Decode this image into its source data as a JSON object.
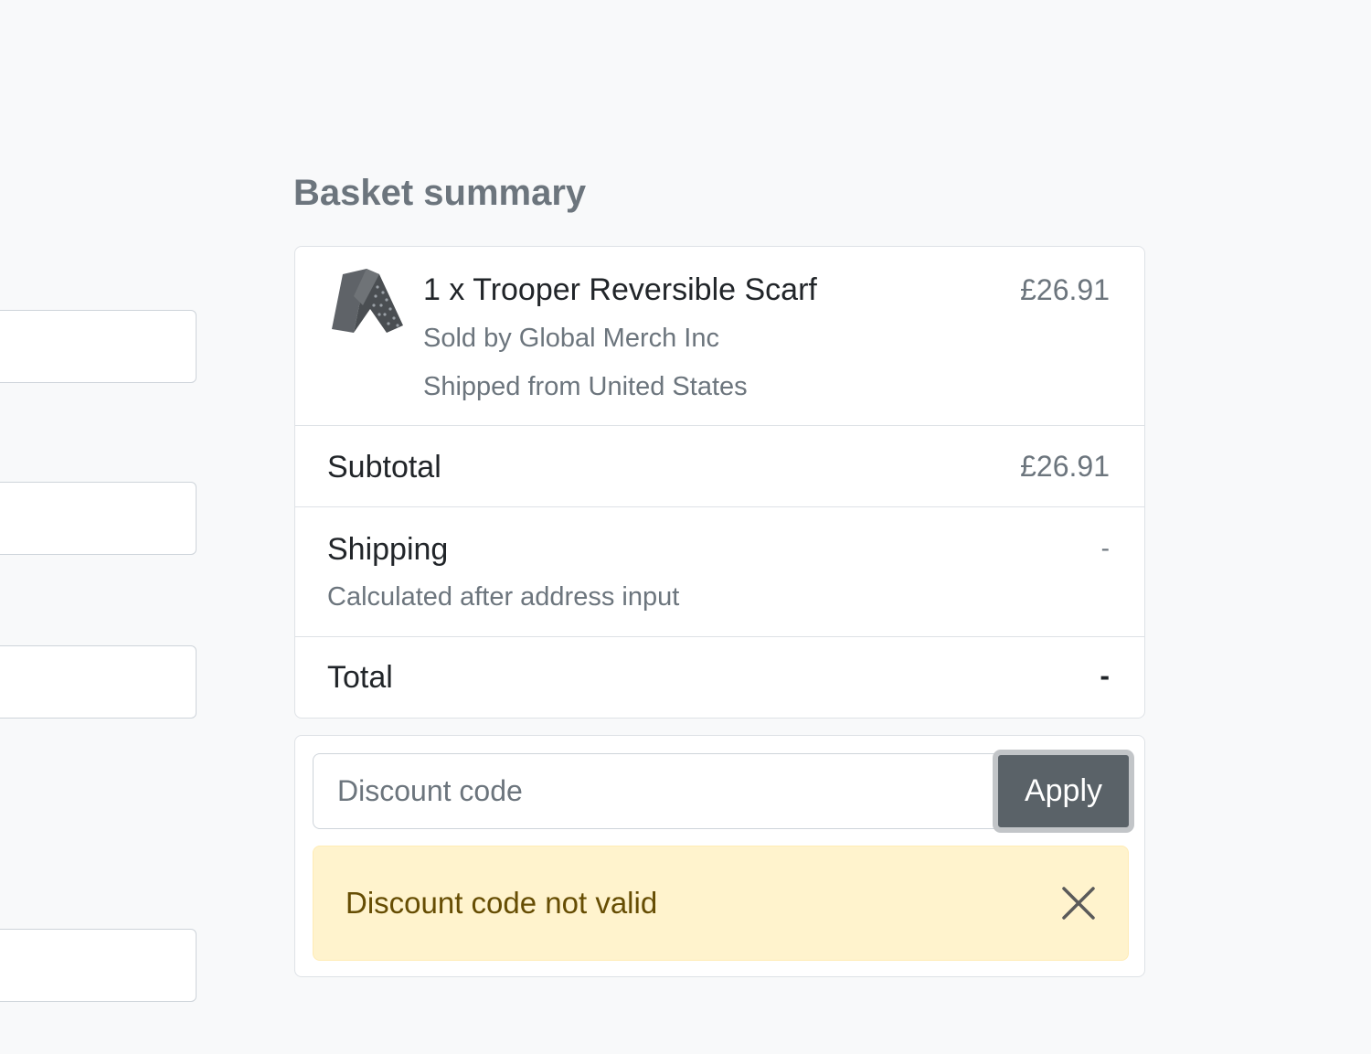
{
  "basket": {
    "title": "Basket summary",
    "item": {
      "name": "1 x Trooper Reversible Scarf",
      "seller": "Sold by Global Merch Inc",
      "shipped_from": "Shipped from United States",
      "price": "£26.91",
      "thumbnail_icon": "scarf-thumbnail"
    },
    "subtotal": {
      "label": "Subtotal",
      "value": "£26.91"
    },
    "shipping": {
      "label": "Shipping",
      "note": "Calculated after address input",
      "value": "-"
    },
    "total": {
      "label": "Total",
      "value": "-"
    }
  },
  "discount": {
    "placeholder": "Discount code",
    "value": "",
    "apply_label": "Apply",
    "alert_message": "Discount code not valid",
    "close_icon": "close-icon"
  },
  "colors": {
    "page_background": "#f8f9fa",
    "muted_text": "#6c757d",
    "button": "#5a6268",
    "alert_background": "#fff3cd",
    "alert_text": "#664d03"
  }
}
